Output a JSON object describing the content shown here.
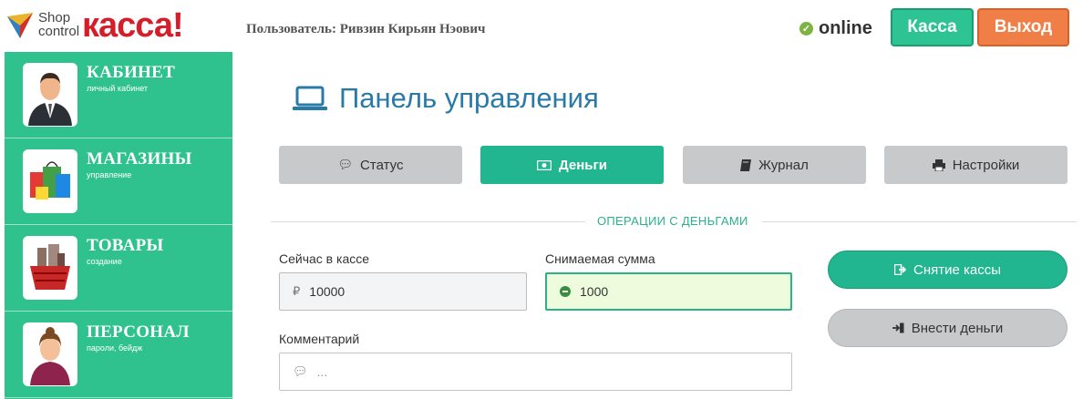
{
  "logo": {
    "shop": "Shop",
    "control": "control",
    "kassa": "касса!"
  },
  "user": {
    "line": "Пользователь: Ривзин Кирьян Нэович"
  },
  "status": {
    "text": "online",
    "color": "#7cb342"
  },
  "header_buttons": {
    "kassa": "Касса",
    "exit": "Выход"
  },
  "sidebar": {
    "items": [
      {
        "title": "КАБИНЕТ",
        "subtitle": "личный кабинет",
        "icon": "businessman-icon"
      },
      {
        "title": "МАГАЗИНЫ",
        "subtitle": "управление",
        "icon": "shopping-bags-icon"
      },
      {
        "title": "ТОВАРЫ",
        "subtitle": "создание",
        "icon": "basket-icon"
      },
      {
        "title": "ПЕРСОНАЛ",
        "subtitle": "пароли, бейдж",
        "icon": "employee-icon"
      }
    ]
  },
  "main": {
    "title": "Панель управления",
    "tabs": [
      {
        "label": "Статус",
        "icon": "comment-icon",
        "active": false
      },
      {
        "label": "Деньги",
        "icon": "money-icon",
        "active": true
      },
      {
        "label": "Журнал",
        "icon": "book-icon",
        "active": false
      },
      {
        "label": "Настройки",
        "icon": "printer-icon",
        "active": false
      }
    ],
    "section_title": "ОПЕРАЦИИ С ДЕНЬГАМИ",
    "form": {
      "in_cash_label": "Сейчас в кассе",
      "in_cash_currency": "₽",
      "in_cash_value": "10000",
      "withdraw_label": "Снимаемая сумма",
      "withdraw_value": "1000",
      "comment_label": "Комментарий",
      "comment_placeholder": "..."
    },
    "actions": {
      "withdraw": "Снятие кассы",
      "deposit": "Внести деньги"
    }
  },
  "colors": {
    "accent": "#2fc28f",
    "active_tab": "#21b590",
    "exit": "#f07f47",
    "title": "#2a7aa8"
  }
}
